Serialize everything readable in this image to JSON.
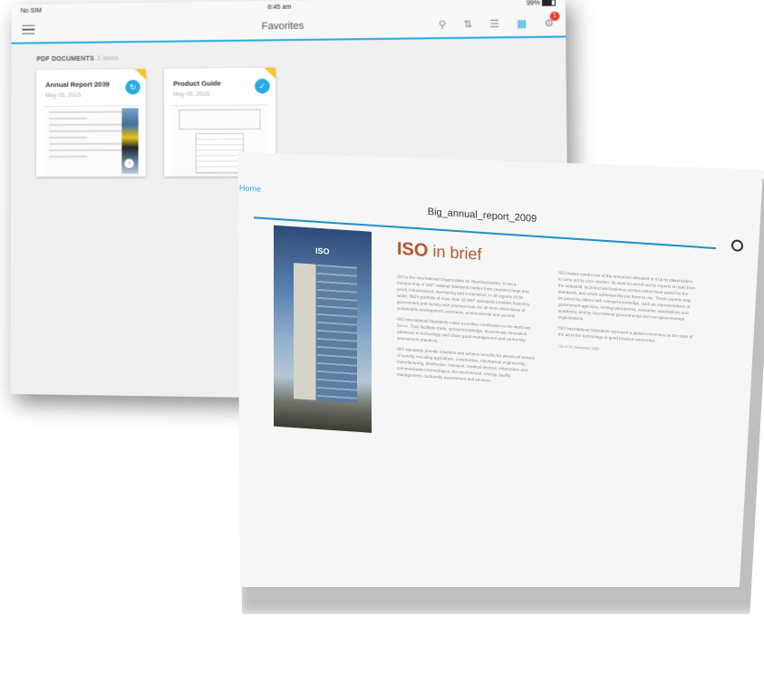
{
  "back": {
    "status": {
      "carrier": "No SIM",
      "time": "8:45 am",
      "battery": "99%"
    },
    "nav": {
      "title": "Favorites",
      "badge": "1"
    },
    "section": {
      "label": "PDF DOCUMENTS",
      "count": "2 items"
    },
    "cards": [
      {
        "title": "Annual Report 2009",
        "date": "May 05, 2015"
      },
      {
        "title": "Product Guide",
        "date": "May 05, 2015"
      }
    ]
  },
  "front": {
    "home": "Home",
    "doc_title": "Big_annual_report_2009",
    "heading_bold": "ISO",
    "heading_rest": " in brief",
    "photo_logo": "ISO",
    "col1": [
      "ISO is the International Organization for Standardization. It has a membership of 163* national standards bodies from countries large and small, industrialized, developing and in transition, in all regions of the world. ISO's portfolio of more than 18 000* standards provides business, government and society with practical tools for all three dimensions of sustainable development: economic, environmental and societal.",
      "ISO International Standards make a positive contribution to the world we live in. They facilitate trade, spread knowledge, disseminate innovative advances in technology, and share good management and conformity assessment practices.",
      "ISO standards provide solutions and achieve benefits for almost all sectors of activity, including agriculture, construction, mechanical engineering, manufacturing, distribution, transport, medical devices, information and communication technologies, the environment, energy, quality management, conformity assessment and services."
    ],
    "col2": [
      "ISO makes careful use of the resources allocated to it by its stakeholders to carry out its core mission. Its work is carried out by experts on loan from the industrial, technical and business sectors which have asked for the standards, and which subsequently put them to use. These experts may be joined by others with relevant knowledge, such as representatives of government agencies, testing laboratories, consumer associations and academia, and by international governmental and non-governmental organizations.",
      "ISO International Standards represent a global consensus on the state of the art in the technology or good practice concerned."
    ],
    "col2_date": "*as of 31 December 2009"
  }
}
